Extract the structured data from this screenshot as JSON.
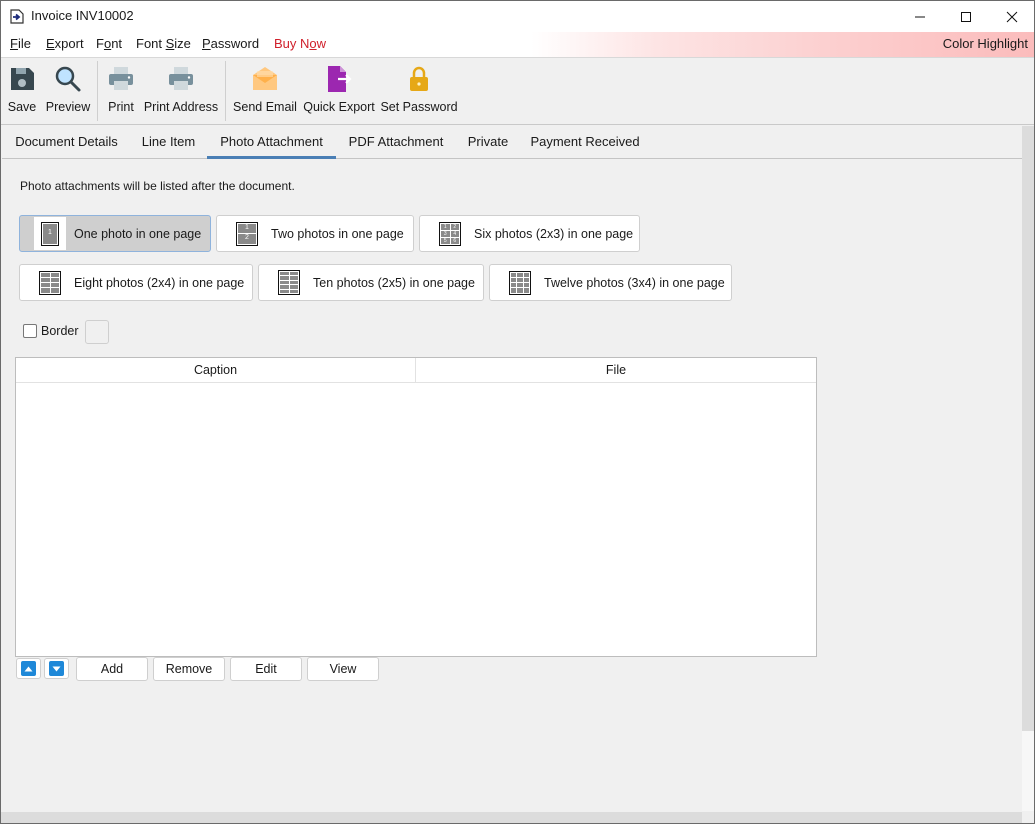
{
  "window": {
    "title": "Invoice INV10002",
    "icons": {
      "app": "document-arrow-icon",
      "minimize": "minimize-icon",
      "maximize": "maximize-icon",
      "close": "close-icon"
    }
  },
  "menu": {
    "items": [
      {
        "label": "File",
        "underline": "F"
      },
      {
        "label": "Export",
        "underline": "E"
      },
      {
        "label": "Font",
        "underline": "o"
      },
      {
        "label": "Font Size",
        "underline": "S"
      },
      {
        "label": "Password",
        "underline": "P"
      },
      {
        "label": "Buy Now",
        "underline": "o"
      }
    ],
    "buy_now_color": "#d0202b",
    "color_highlight": "Color Highlight"
  },
  "toolbar": {
    "save": "Save",
    "preview": "Preview",
    "print": "Print",
    "print_address": "Print Address",
    "send_email": "Send Email",
    "quick_export": "Quick Export",
    "set_password": "Set Password"
  },
  "tabs": [
    {
      "label": "Document Details",
      "active": false
    },
    {
      "label": "Line Item",
      "active": false
    },
    {
      "label": "Photo Attachment",
      "active": true
    },
    {
      "label": "PDF Attachment",
      "active": false
    },
    {
      "label": "Private",
      "active": false
    },
    {
      "label": "Payment Received",
      "active": false
    }
  ],
  "photo_attachment": {
    "info": "Photo attachments will be listed after the document.",
    "layouts": [
      {
        "label": "One photo in one page",
        "selected": true
      },
      {
        "label": "Two photos in one page",
        "selected": false
      },
      {
        "label": "Six photos (2x3) in one page",
        "selected": false
      },
      {
        "label": "Eight photos (2x4) in one page",
        "selected": false
      },
      {
        "label": "Ten photos (2x5) in one page",
        "selected": false
      },
      {
        "label": "Twelve photos (3x4) in one page",
        "selected": false
      }
    ],
    "border_label": "Border",
    "border_checked": false,
    "table": {
      "columns": [
        "Caption",
        "File"
      ],
      "rows": []
    },
    "buttons": {
      "move_up": "move-up-icon",
      "move_down": "move-down-icon",
      "add": "Add",
      "remove": "Remove",
      "edit": "Edit",
      "view": "View"
    }
  },
  "colors": {
    "accent_tab": "#4a7fb5",
    "arrow_button": "#1e88d8"
  }
}
